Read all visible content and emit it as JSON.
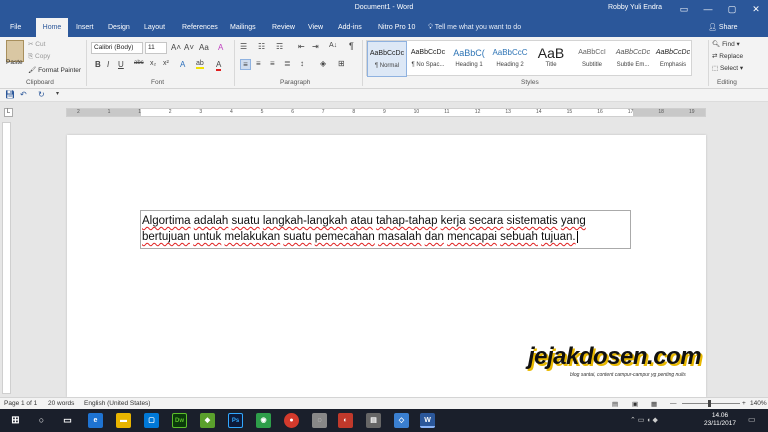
{
  "window": {
    "title": "Document1 - Word",
    "user": "Robby Yuli Endra",
    "controls": [
      "▭",
      "—",
      "▢",
      "✕"
    ]
  },
  "tabs": [
    "File",
    "Home",
    "Insert",
    "Design",
    "Layout",
    "References",
    "Mailings",
    "Review",
    "View",
    "Add-ins",
    "Nitro Pro 10"
  ],
  "tell_me": "Tell me what you want to do",
  "share": "Share",
  "clipboard": {
    "paste": "Paste",
    "cut": "Cut",
    "copy": "Copy",
    "format_painter": "Format Painter",
    "label": "Clipboard"
  },
  "font": {
    "name": "Calibri (Body)",
    "size": "11",
    "label": "Font",
    "bold": "B",
    "italic": "I",
    "underline": "U",
    "strike": "abc",
    "subscript": "x₂",
    "superscript": "x²",
    "grow": "A˄",
    "shrink": "A˅",
    "case": "Aa",
    "clear": "A",
    "text_effects": "A",
    "highlight": "ab",
    "font_color": "A"
  },
  "paragraph": {
    "label": "Paragraph",
    "pilcrow": "¶",
    "sort": "A↓"
  },
  "styles": {
    "label": "Styles",
    "items": [
      {
        "preview": "AaBbCcDc",
        "name": "¶ Normal"
      },
      {
        "preview": "AaBbCcDc",
        "name": "¶ No Spac..."
      },
      {
        "preview": "AaBbC(",
        "name": "Heading 1"
      },
      {
        "preview": "AaBbCcC",
        "name": "Heading 2"
      },
      {
        "preview": "AaB",
        "name": "Title"
      },
      {
        "preview": "AaBbCcI",
        "name": "Subtitle"
      },
      {
        "preview": "AaBbCcDc",
        "name": "Subtle Em..."
      },
      {
        "preview": "AaBbCcDc",
        "name": "Emphasis"
      }
    ]
  },
  "editing": {
    "find": "Find",
    "replace": "Replace",
    "select": "Select",
    "label": "Editing"
  },
  "ruler": {
    "ticks": [
      "2",
      "1",
      "1",
      "2",
      "3",
      "4",
      "5",
      "6",
      "7",
      "8",
      "9",
      "10",
      "11",
      "12",
      "13",
      "14",
      "15",
      "16",
      "17",
      "18",
      "19"
    ]
  },
  "document": {
    "words": [
      "Algortima",
      "adalah",
      "suatu",
      "langkah-langkah",
      "atau",
      "tahap-tahap",
      "kerja",
      "secara",
      "sistematis",
      "yang",
      "bertujuan",
      "untuk",
      "melakukan",
      "suatu",
      "pemecahan",
      "masalah",
      "dan",
      "mencapai",
      "sebuah",
      "tujuan."
    ]
  },
  "watermark": {
    "logo": "jejakdosen.com",
    "tagline": "blog santai, content campur-campur yg penting nulis"
  },
  "status": {
    "page": "Page 1 of 1",
    "words": "20 words",
    "language": "English (United States)",
    "zoom": "140%"
  },
  "taskbar": {
    "time": "14.06",
    "date": "23/11/2017"
  }
}
